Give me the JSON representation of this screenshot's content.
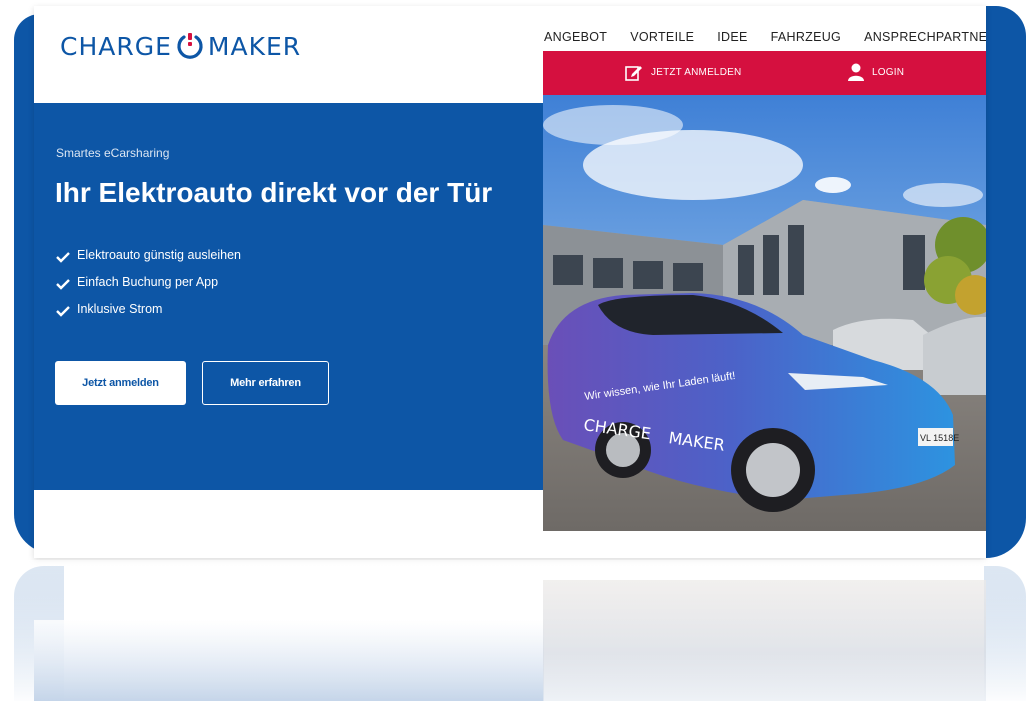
{
  "brand": {
    "logo_left": "CHARGE",
    "logo_right": "MAKER",
    "primary_color": "#0d56a6",
    "accent_color": "#d5103f"
  },
  "nav": {
    "items": [
      "ANGEBOT",
      "VORTEILE",
      "IDEE",
      "FAHRZEUG",
      "ANSPRECHPARTNER"
    ]
  },
  "topbar": {
    "register_icon": "edit-icon",
    "register_label": "JETZT ANMELDEN",
    "login_icon": "user-icon",
    "login_label": "LOGIN"
  },
  "hero": {
    "subtitle": "Smartes eCarsharing",
    "headline": "Ihr Elektroauto direkt vor der Tür",
    "features": [
      "Elektroauto günstig ausleihen",
      "Einfach Buchung per App",
      "Inklusive Strom"
    ],
    "feature_icon": "check-icon",
    "primary_button": "Jetzt anmelden",
    "secondary_button": "Mehr erfahren"
  },
  "photo": {
    "car_slogan": "Wir wissen, wie Ihr Laden läuft!",
    "car_logo_left": "CHARGE",
    "car_logo_right": "MAKER",
    "plate": "VL 1518E"
  }
}
